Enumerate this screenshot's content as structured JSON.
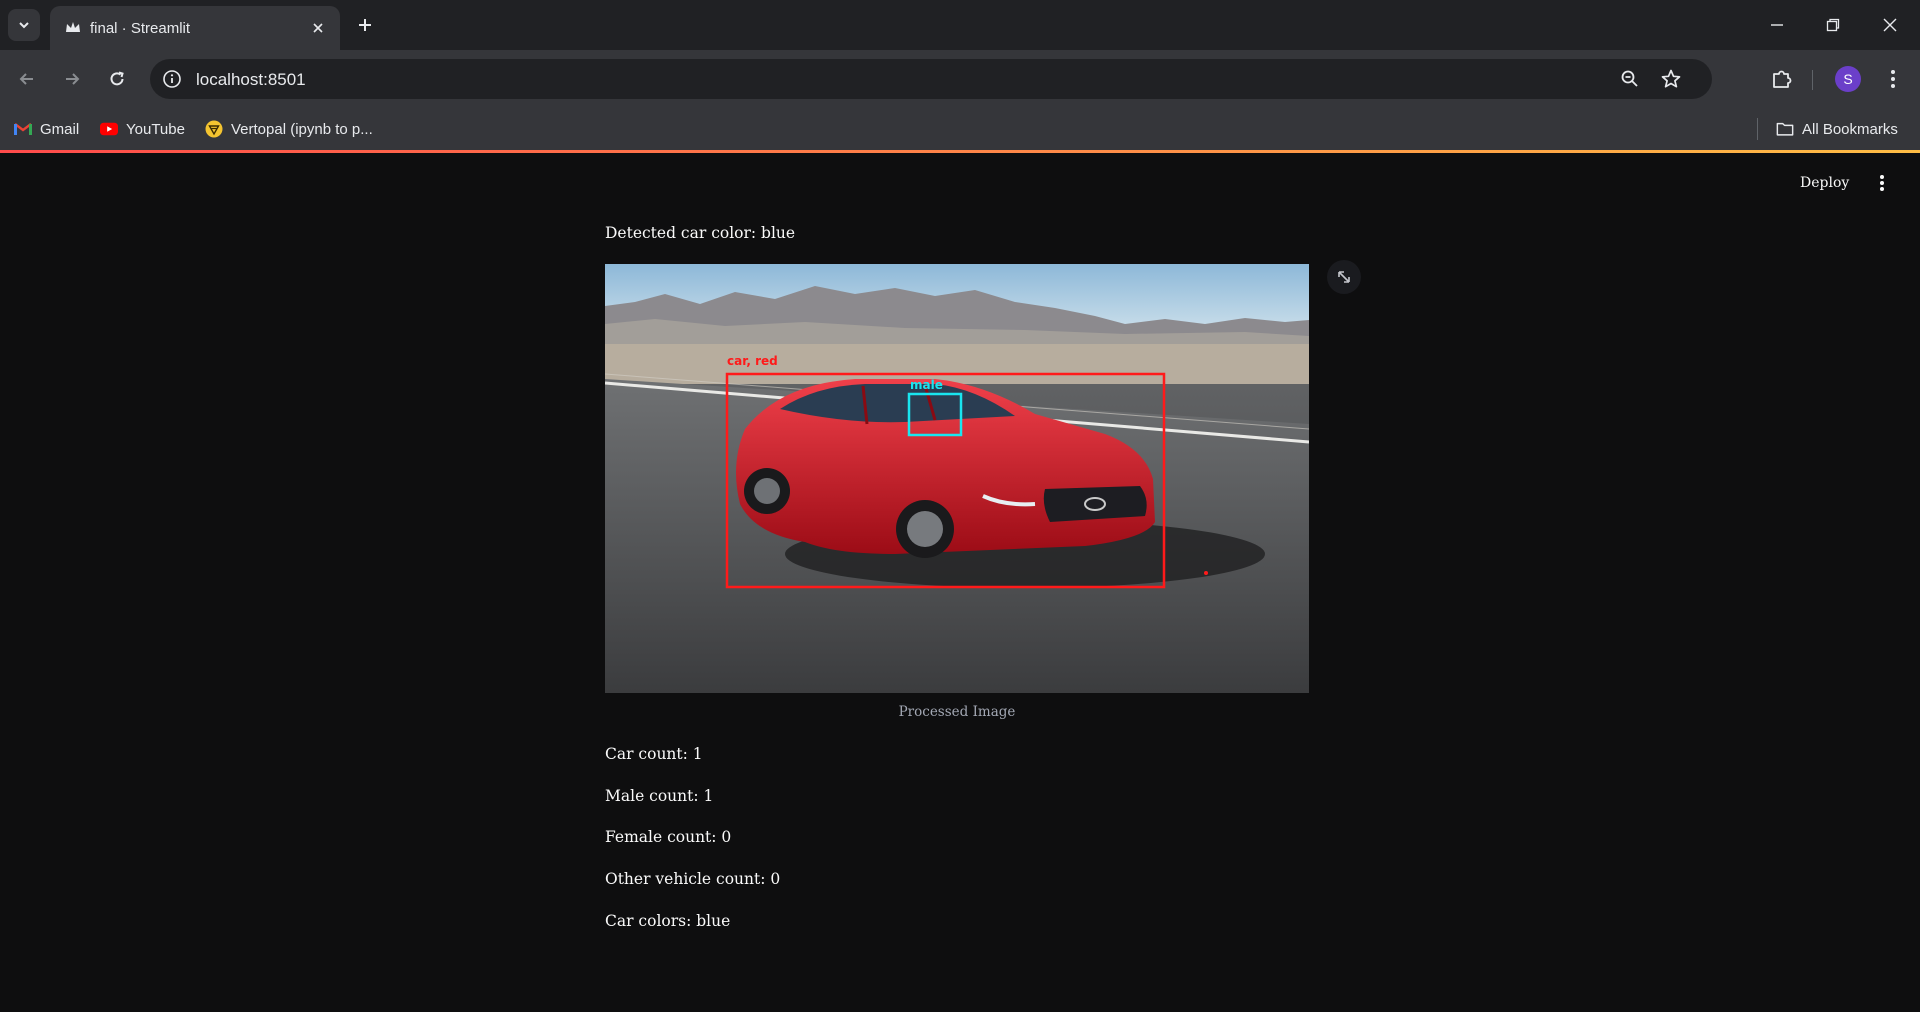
{
  "browser": {
    "tab_title": "final · Streamlit",
    "url": "localhost:8501",
    "profile_initial": "S",
    "bookmarks": [
      {
        "label": "Gmail",
        "icon": "gmail-icon"
      },
      {
        "label": "YouTube",
        "icon": "youtube-icon"
      },
      {
        "label": "Vertopal (ipynb to p...",
        "icon": "vertopal-icon"
      }
    ],
    "all_bookmarks": "All Bookmarks",
    "accent_gradient": [
      "#ff4b4b",
      "#ffbd45"
    ]
  },
  "app": {
    "deploy_label": "Deploy",
    "detected_color": "Detected car color: blue",
    "image": {
      "caption": "Processed Image",
      "car_label": "car,  red",
      "person_label": "male",
      "car_box_color": "#ff1a1a",
      "person_box_color": "#19e6f0"
    },
    "stats": [
      "Car count: 1",
      "Male count: 1",
      "Female count: 0",
      "Other vehicle count: 0",
      "Car colors: blue"
    ]
  }
}
